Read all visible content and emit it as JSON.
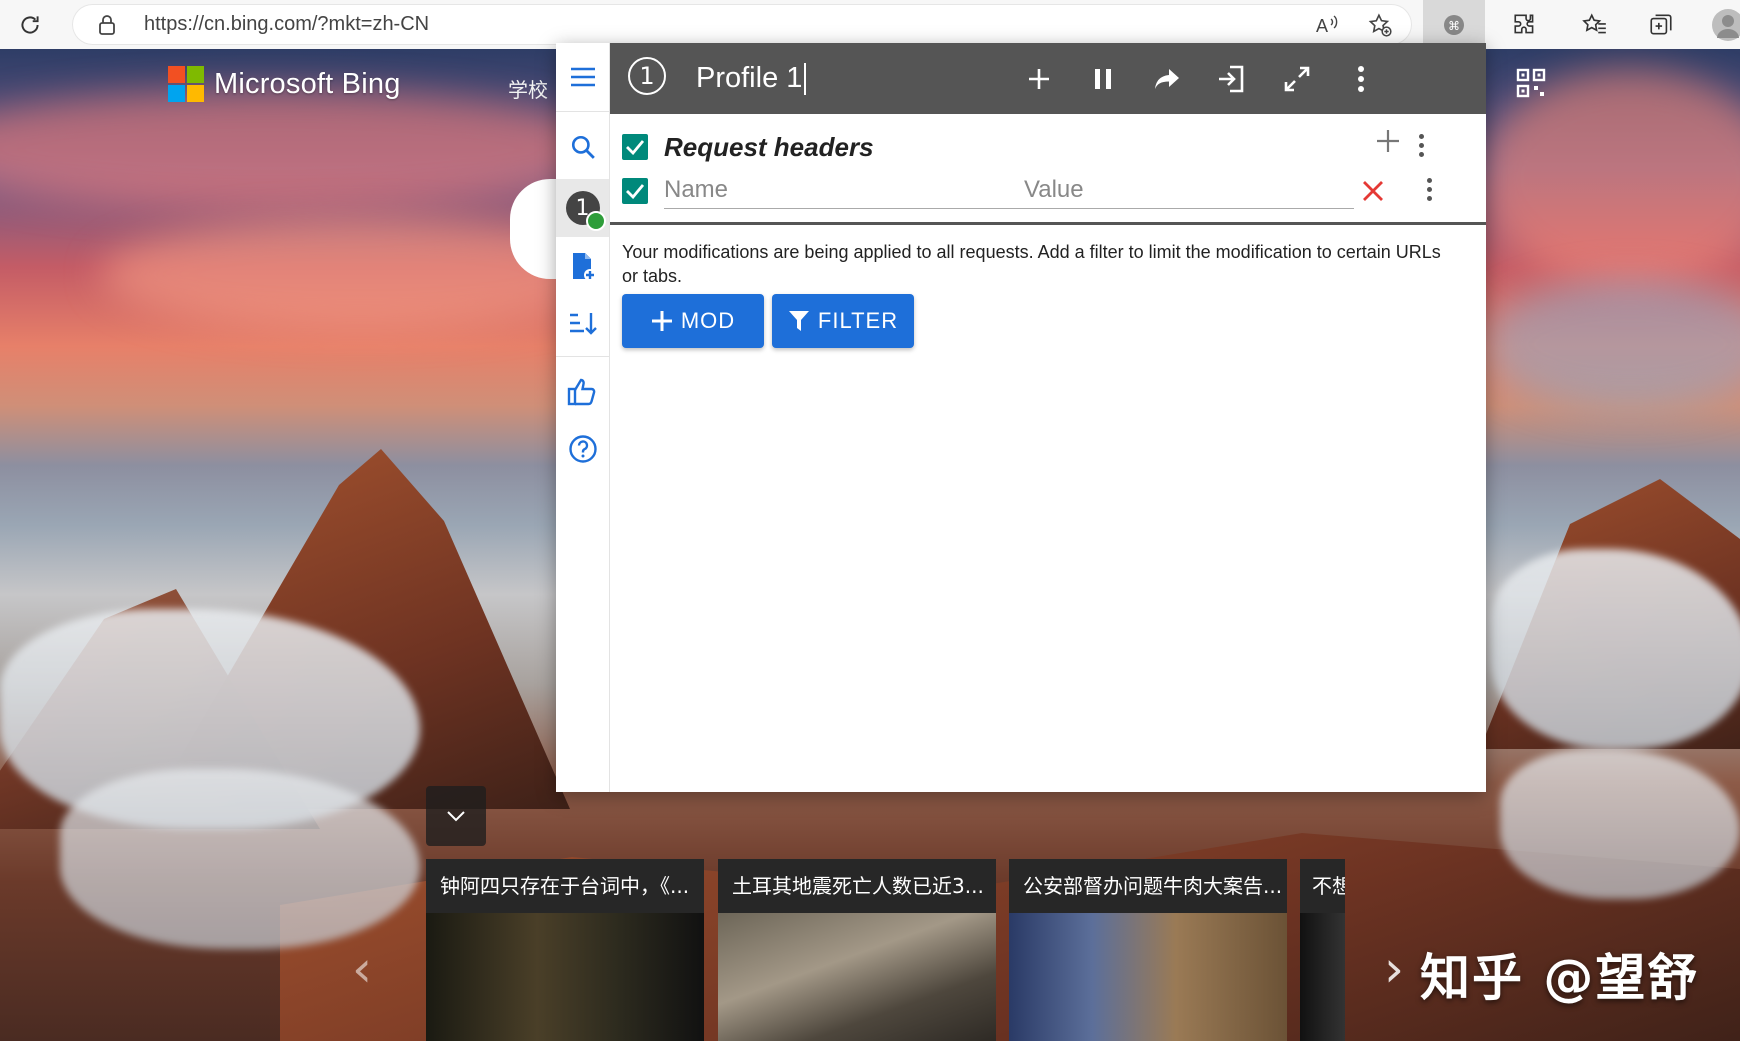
{
  "browser": {
    "url": "https://cn.bing.com/?mkt=zh-CN",
    "icons": [
      "refresh-icon",
      "lock-icon",
      "read-aloud-icon",
      "add-favorite-icon",
      "extension-active-icon",
      "extensions-icon",
      "favorites-icon",
      "collections-icon",
      "profile-avatar"
    ]
  },
  "bing": {
    "logo_text": "Microsoft Bing",
    "nav_item": "学校",
    "logo_colors": [
      "#f25022",
      "#7fba00",
      "#00a4ef",
      "#ffb900"
    ]
  },
  "popup": {
    "profile_number": "1",
    "profile_name": "Profile 1",
    "toolbar_icons": [
      "add-icon",
      "pause-icon",
      "share-icon",
      "import-icon",
      "fullscreen-icon",
      "more-vert-icon"
    ],
    "sidebar_icons": [
      "menu-icon",
      "search-icon",
      "profile-1-icon",
      "add-file-icon",
      "sort-icon",
      "thumbs-up-icon",
      "help-icon"
    ],
    "section_title": "Request headers",
    "name_placeholder": "Name",
    "value_placeholder": "Value",
    "notice": "Your modifications are being applied to all requests. Add a filter to limit the modification to certain URLs or tabs.",
    "mod_button": "MOD",
    "filter_button": "FILTER",
    "accent_color": "#1e6fd9",
    "check_color": "#00897b",
    "toolbar_color": "#555555"
  },
  "news": [
    {
      "caption": "钟阿四只存在于台词中，《..."
    },
    {
      "caption": "土耳其地震死亡人数已近3..."
    },
    {
      "caption": "公安部督办问题牛肉大案告..."
    },
    {
      "caption": "不想"
    }
  ],
  "watermark": "知乎 @望舒"
}
